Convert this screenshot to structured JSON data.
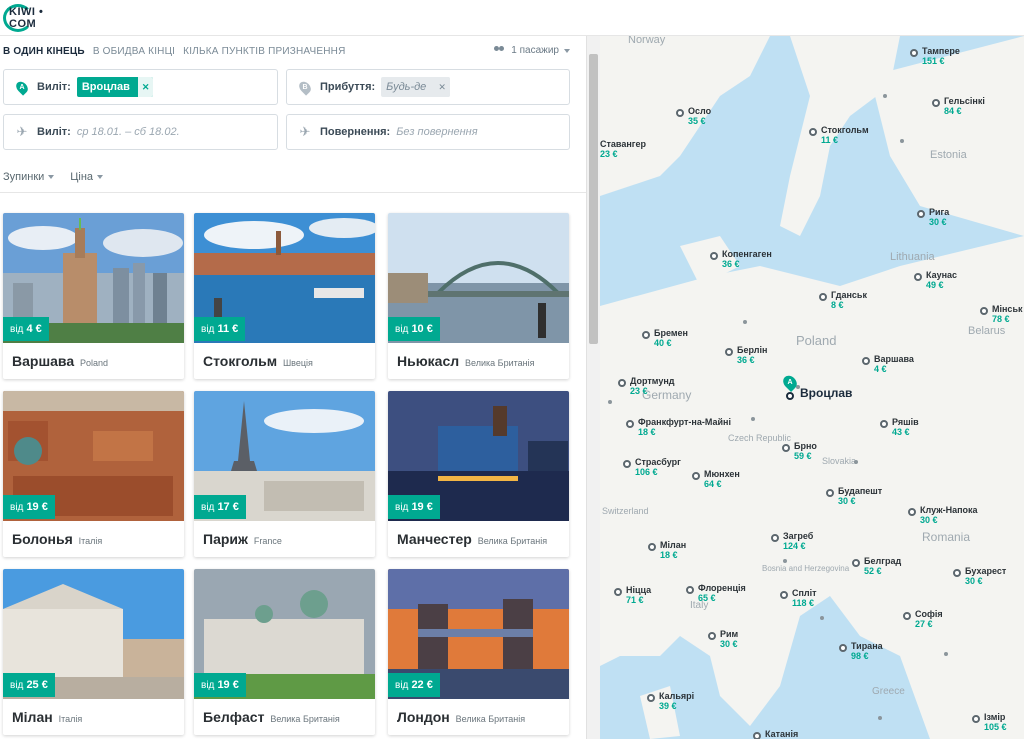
{
  "brand": {
    "logo_text": "KIWI • COM"
  },
  "search": {
    "tabs": [
      {
        "label": "В ОДИН КІНЕЦЬ",
        "active": true
      },
      {
        "label": "В ОБИДВА КІНЦІ",
        "active": false
      },
      {
        "label": "КІЛЬКА ПУНКТІВ ПРИЗНАЧЕННЯ",
        "active": false
      }
    ],
    "passengers": "1 пасажир",
    "from_label": "Виліт:",
    "from_value": "Вроцлав",
    "to_label": "Прибуття:",
    "to_value": "Будь-де",
    "depart_label": "Виліт:",
    "depart_placeholder": "ср 18.01. – сб 18.02.",
    "return_label": "Повернення:",
    "return_placeholder": "Без повернення",
    "filters": {
      "stops": "Зупинки",
      "price": "Ціна"
    }
  },
  "accent_color": "#00a991",
  "destinations": [
    {
      "city": "Варшава",
      "country": "Poland",
      "price_prefix": "від",
      "price": "4 €"
    },
    {
      "city": "Стокгольм",
      "country": "Швеція",
      "price_prefix": "від",
      "price": "11 €"
    },
    {
      "city": "Ньюкасл",
      "country": "Велика Британія",
      "price_prefix": "від",
      "price": "10 €"
    },
    {
      "city": "Болонья",
      "country": "Італія",
      "price_prefix": "від",
      "price": "19 €"
    },
    {
      "city": "Париж",
      "country": "France",
      "price_prefix": "від",
      "price": "17 €"
    },
    {
      "city": "Манчестер",
      "country": "Велика Британія",
      "price_prefix": "від",
      "price": "19 €"
    },
    {
      "city": "Мілан",
      "country": "Італія",
      "price_prefix": "від",
      "price": "25 €"
    },
    {
      "city": "Белфаст",
      "country": "Велика Британія",
      "price_prefix": "від",
      "price": "19 €"
    },
    {
      "city": "Лондон",
      "country": "Велика Британія",
      "price_prefix": "від",
      "price": "22 €"
    }
  ],
  "map": {
    "origin": {
      "letter": "A",
      "name": "Вроцлав"
    },
    "countries": [
      "Norway",
      "Estonia",
      "Lithuania",
      "Belarus",
      "Poland",
      "Germany",
      "Czech Republic",
      "Slovakia",
      "Romania",
      "Italy",
      "Greece",
      "Switzerland",
      "Bosnia and Herzegovina"
    ],
    "cities": [
      {
        "name": "Тампере",
        "price": "151 €"
      },
      {
        "name": "Гельсінкі",
        "price": "84 €"
      },
      {
        "name": "Осло",
        "price": "35 €"
      },
      {
        "name": "Стокгольм",
        "price": "11 €"
      },
      {
        "name": "Ставангер",
        "price": "23 €"
      },
      {
        "name": "Рига",
        "price": "30 €"
      },
      {
        "name": "Копенгаген",
        "price": "36 €"
      },
      {
        "name": "Каунас",
        "price": "49 €"
      },
      {
        "name": "Гданськ",
        "price": "8 €"
      },
      {
        "name": "Мінськ",
        "price": "78 €"
      },
      {
        "name": "Бремен",
        "price": "40 €"
      },
      {
        "name": "Берлін",
        "price": "36 €"
      },
      {
        "name": "Варшава",
        "price": "4 €"
      },
      {
        "name": "Дортмунд",
        "price": "23 €"
      },
      {
        "name": "Франкфурт-на-Майні",
        "price": "18 €"
      },
      {
        "name": "Ряшів",
        "price": "43 €"
      },
      {
        "name": "Брно",
        "price": "59 €"
      },
      {
        "name": "Страсбург",
        "price": "106 €"
      },
      {
        "name": "Мюнхен",
        "price": "64 €"
      },
      {
        "name": "Будапешт",
        "price": "30 €"
      },
      {
        "name": "Клуж-Напока",
        "price": "30 €"
      },
      {
        "name": "Загреб",
        "price": "124 €"
      },
      {
        "name": "Мілан",
        "price": "18 €"
      },
      {
        "name": "Белград",
        "price": "52 €"
      },
      {
        "name": "Бухарест",
        "price": "30 €"
      },
      {
        "name": "Ніцца",
        "price": "71 €"
      },
      {
        "name": "Флоренція",
        "price": "65 €"
      },
      {
        "name": "Спліт",
        "price": "118 €"
      },
      {
        "name": "Софія",
        "price": "27 €"
      },
      {
        "name": "Рим",
        "price": "30 €"
      },
      {
        "name": "Тирана",
        "price": "98 €"
      },
      {
        "name": "Кальярі",
        "price": "39 €"
      },
      {
        "name": "Ізмір",
        "price": "105 €"
      },
      {
        "name": "Катанія",
        "price": ""
      }
    ]
  }
}
